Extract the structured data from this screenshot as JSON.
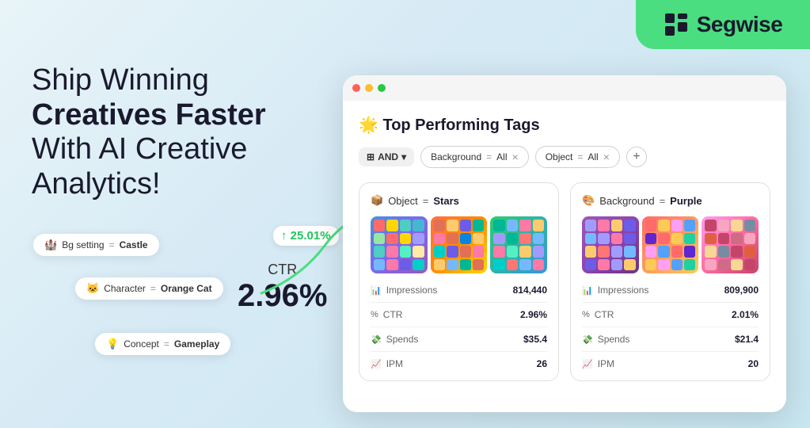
{
  "brand": {
    "name": "Segwise",
    "logo_icon": "▪",
    "bg_color": "#4ade80"
  },
  "hero": {
    "line1_normal": "Ship Winning",
    "line2_bold": "Creatives Faster",
    "line3_normal": "With AI Creative",
    "line4_normal": "Analytics!"
  },
  "floating_tags": [
    {
      "id": "bg-setting",
      "icon": "🏰",
      "label": "Bg setting",
      "eq": "=",
      "value": "Castle"
    },
    {
      "id": "character",
      "icon": "🐱",
      "label": "Character",
      "eq": "=",
      "value": "Orange Cat"
    },
    {
      "id": "concept",
      "icon": "💡",
      "label": "Concept",
      "eq": "=",
      "value": "Gameplay"
    }
  ],
  "ctr": {
    "label": "CTR",
    "value": "2.96%"
  },
  "growth": {
    "value": "↑ 25.01%"
  },
  "dashboard": {
    "title": "🌟 Top Performing Tags",
    "filters": {
      "operator": "AND",
      "operator_icon": "⊞",
      "chips": [
        {
          "label": "Background",
          "eq": "=",
          "value": "All"
        },
        {
          "label": "Object",
          "eq": "=",
          "value": "All"
        }
      ],
      "add_label": "+"
    },
    "cards": [
      {
        "id": "stars-card",
        "tag_icon": "📦",
        "tag_label": "Object",
        "tag_eq": "=",
        "tag_value": "Stars",
        "metrics": [
          {
            "icon": "📊",
            "label": "Impressions",
            "value": "814,440"
          },
          {
            "icon": "%",
            "label": "CTR",
            "value": "2.96%"
          },
          {
            "icon": "💸",
            "label": "Spends",
            "value": "$35.4"
          },
          {
            "icon": "📈",
            "label": "IPM",
            "value": "26"
          }
        ]
      },
      {
        "id": "purple-card",
        "tag_icon": "🎨",
        "tag_label": "Background",
        "tag_eq": "=",
        "tag_value": "Purple",
        "metrics": [
          {
            "icon": "📊",
            "label": "Impressions",
            "value": "809,900"
          },
          {
            "icon": "%",
            "label": "CTR",
            "value": "2.01%"
          },
          {
            "icon": "💸",
            "label": "Spends",
            "value": "$21.4"
          },
          {
            "icon": "📈",
            "label": "IPM",
            "value": "20"
          }
        ]
      }
    ]
  }
}
